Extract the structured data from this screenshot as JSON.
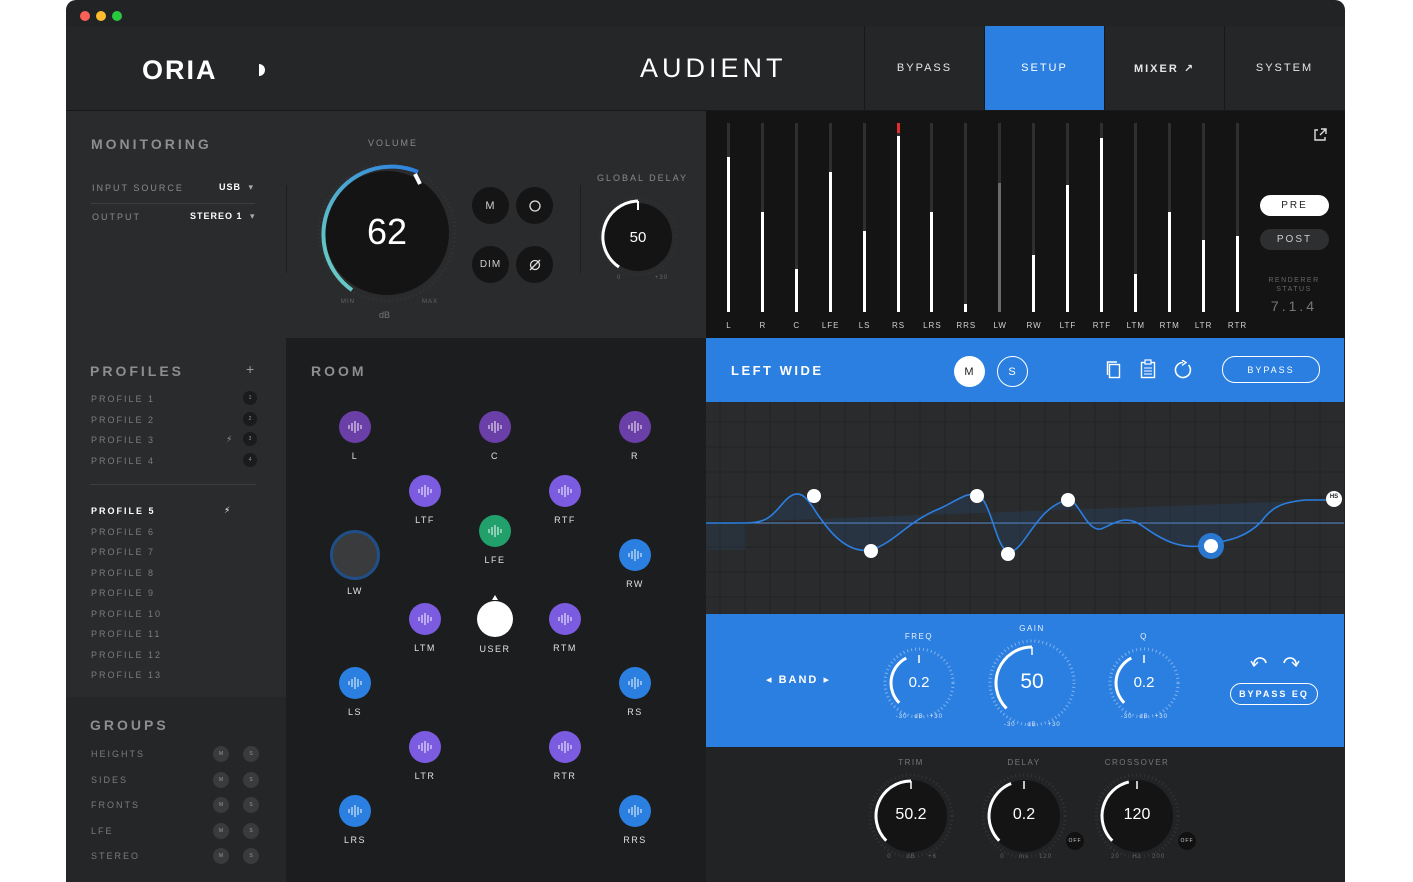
{
  "window": {
    "lights": [
      "#fe5f57",
      "#febc2e",
      "#28c840"
    ]
  },
  "header": {
    "brand": "ORIA",
    "logo": "AUDIENT",
    "tabs": [
      {
        "label": "BYPASS",
        "active": false
      },
      {
        "label": "SETUP",
        "active": true
      },
      {
        "label": "MIXER ↗",
        "active": false
      },
      {
        "label": "SYSTEM",
        "active": false
      }
    ]
  },
  "monitoring": {
    "title": "MONITORING",
    "input_source_label": "INPUT SOURCE",
    "input_source_value": "USB",
    "output_label": "OUTPUT",
    "output_value": "STEREO 1",
    "volume_label": "VOLUME",
    "volume_value": "62",
    "volume_min": "MIN",
    "volume_max": "MAX",
    "volume_unit": "dB",
    "buttons": {
      "mute": "M",
      "dim": "DIM"
    },
    "global_delay_label": "GLOBAL DELAY",
    "global_delay_value": "50",
    "global_delay_min": "0",
    "global_delay_max": "+30"
  },
  "meters": {
    "channels": [
      {
        "name": "L",
        "level": 0.82
      },
      {
        "name": "R",
        "level": 0.53
      },
      {
        "name": "C",
        "level": 0.23
      },
      {
        "name": "LFE",
        "level": 0.74
      },
      {
        "name": "LS",
        "level": 0.43
      },
      {
        "name": "RS",
        "level": 0.93,
        "peak": true
      },
      {
        "name": "LRS",
        "level": 0.53
      },
      {
        "name": "RRS",
        "level": 0.04
      },
      {
        "name": "LW",
        "level": 0.68,
        "dim": true
      },
      {
        "name": "RW",
        "level": 0.3
      },
      {
        "name": "LTF",
        "level": 0.67
      },
      {
        "name": "RTF",
        "level": 0.92
      },
      {
        "name": "LTM",
        "level": 0.2
      },
      {
        "name": "RTM",
        "level": 0.53
      },
      {
        "name": "LTR",
        "level": 0.38
      },
      {
        "name": "RTR",
        "level": 0.4
      }
    ],
    "pre_label": "PRE",
    "post_label": "POST",
    "renderer_status_label": "RENDERER\nSTATUS",
    "renderer_status_value": "7.1.4"
  },
  "profiles": {
    "title": "PROFILES",
    "add_label": "+",
    "group_a": [
      {
        "name": "PROFILE 1",
        "num": "1"
      },
      {
        "name": "PROFILE 2",
        "num": "2"
      },
      {
        "name": "PROFILE 3",
        "num": "3",
        "bolt": true
      },
      {
        "name": "PROFILE 4",
        "num": "4"
      }
    ],
    "group_b": [
      {
        "name": "PROFILE 5",
        "active": true,
        "bolt": true
      },
      {
        "name": "PROFILE 6"
      },
      {
        "name": "PROFILE 7"
      },
      {
        "name": "PROFILE 8"
      },
      {
        "name": "PROFILE 9"
      },
      {
        "name": "PROFILE 10"
      },
      {
        "name": "PROFILE 11"
      },
      {
        "name": "PROFILE 12"
      },
      {
        "name": "PROFILE 13"
      }
    ]
  },
  "groups": {
    "title": "GROUPS",
    "items": [
      "HEIGHTS",
      "SIDES",
      "FRONTS",
      "LFE",
      "STEREO"
    ],
    "m_label": "M",
    "s_label": "S"
  },
  "room": {
    "title": "ROOM",
    "speakers": [
      {
        "name": "L",
        "color": "#6b3fa8"
      },
      {
        "name": "C",
        "color": "#6b3fa8"
      },
      {
        "name": "R",
        "color": "#6b3fa8"
      },
      {
        "name": "LTF",
        "color": "#7b5ce0"
      },
      {
        "name": "RTF",
        "color": "#7b5ce0"
      },
      {
        "name": "LFE",
        "color": "#22a06b"
      },
      {
        "name": "LW",
        "color": "#3a3b3d"
      },
      {
        "name": "RW",
        "color": "#2b7fe0"
      },
      {
        "name": "LTM",
        "color": "#7b5ce0"
      },
      {
        "name": "USER",
        "color": "#ffffff"
      },
      {
        "name": "RTM",
        "color": "#7b5ce0"
      },
      {
        "name": "LS",
        "color": "#2b7fe0"
      },
      {
        "name": "RS",
        "color": "#2b7fe0"
      },
      {
        "name": "LTR",
        "color": "#7b5ce0"
      },
      {
        "name": "RTR",
        "color": "#7b5ce0"
      },
      {
        "name": "LRS",
        "color": "#2b7fe0"
      },
      {
        "name": "RRS",
        "color": "#2b7fe0"
      }
    ]
  },
  "channel": {
    "name": "LEFT WIDE",
    "mute": "M",
    "solo": "S",
    "bypass": "BYPASS",
    "eq_hs_label": "HS"
  },
  "eq": {
    "band_label": "BAND",
    "freq_label": "FREQ",
    "freq_value": "0.2",
    "freq_min": "-30",
    "freq_unit": "dB",
    "freq_max": "+30",
    "gain_label": "GAIN",
    "gain_value": "50",
    "gain_min": "-30",
    "gain_unit": "dB",
    "gain_max": "+30",
    "q_label": "Q",
    "q_value": "0.2",
    "q_min": "-30",
    "q_unit": "dB",
    "q_max": "+30",
    "bypass_eq": "BYPASS EQ"
  },
  "bottom": {
    "trim_label": "TRIM",
    "trim_value": "50.2",
    "trim_min": "0",
    "trim_unit": "dB",
    "trim_max": "+6",
    "delay_label": "DELAY",
    "delay_value": "0.2",
    "delay_min": "0",
    "delay_unit": "ms",
    "delay_max": "120",
    "crossover_label": "CROSSOVER",
    "crossover_value": "120",
    "crossover_min": "20",
    "crossover_unit": "Hz",
    "crossover_max": "200",
    "off_label": "OFF"
  }
}
